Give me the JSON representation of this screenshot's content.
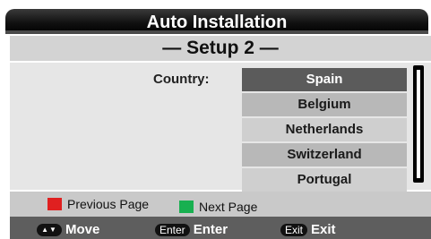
{
  "window": {
    "title": "Auto Installation"
  },
  "header": {
    "title": "— Setup 2 —"
  },
  "form": {
    "country_label": "Country:",
    "countries": [
      {
        "name": "Spain",
        "selected": true
      },
      {
        "name": "Belgium",
        "selected": false
      },
      {
        "name": "Netherlands",
        "selected": false
      },
      {
        "name": "Switzerland",
        "selected": false
      },
      {
        "name": "Portugal",
        "selected": false
      }
    ]
  },
  "legend": {
    "previous": {
      "label": "Previous Page",
      "color": "#e02020"
    },
    "next": {
      "label": "Next Page",
      "color": "#18b050"
    }
  },
  "footer": {
    "move": {
      "key_icon": "up-down-arrows-icon",
      "label": "Move"
    },
    "enter": {
      "key": "Enter",
      "label": "Enter"
    },
    "exit": {
      "key": "Exit",
      "label": "Exit"
    }
  }
}
